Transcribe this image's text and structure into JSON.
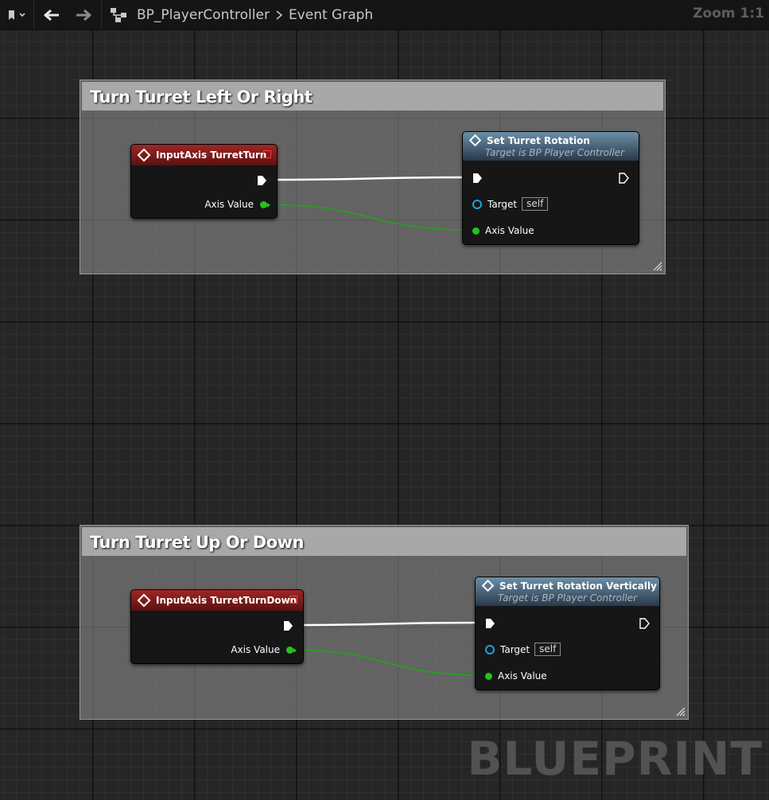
{
  "toolbar": {
    "blueprint_name": "BP_PlayerController",
    "graph_name": "Event Graph",
    "zoom": "Zoom 1:1"
  },
  "comments": [
    {
      "title": "Turn Turret Left Or Right",
      "event_node": {
        "title": "InputAxis TurretTurn",
        "axis_label": "Axis Value"
      },
      "func_node": {
        "title": "Set Turret Rotation",
        "subtitle": "Target is BP Player Controller",
        "target_label": "Target",
        "target_value": "self",
        "axis_label": "Axis Value"
      }
    },
    {
      "title": "Turn Turret Up Or Down",
      "event_node": {
        "title": "InputAxis TurretTurnDown",
        "axis_label": "Axis Value"
      },
      "func_node": {
        "title": "Set Turret Rotation Vertically",
        "subtitle": "Target is BP Player Controller",
        "target_label": "Target",
        "target_value": "self",
        "axis_label": "Axis Value"
      }
    }
  ],
  "watermark": "BLUEPRINT",
  "colors": {
    "exec_wire": "#ffffff",
    "float_wire": "#22a41a",
    "event_header": "#a02525",
    "function_header": "#4b6a84",
    "float_pin": "#22c41a",
    "object_pin": "#1aa3e0"
  },
  "icons": [
    "bookmark-icon",
    "back-arrow-icon",
    "forward-arrow-icon",
    "blueprint-graph-icon",
    "event-diamond-icon",
    "function-diamond-icon",
    "exec-pin-icon",
    "resize-grip-icon"
  ]
}
